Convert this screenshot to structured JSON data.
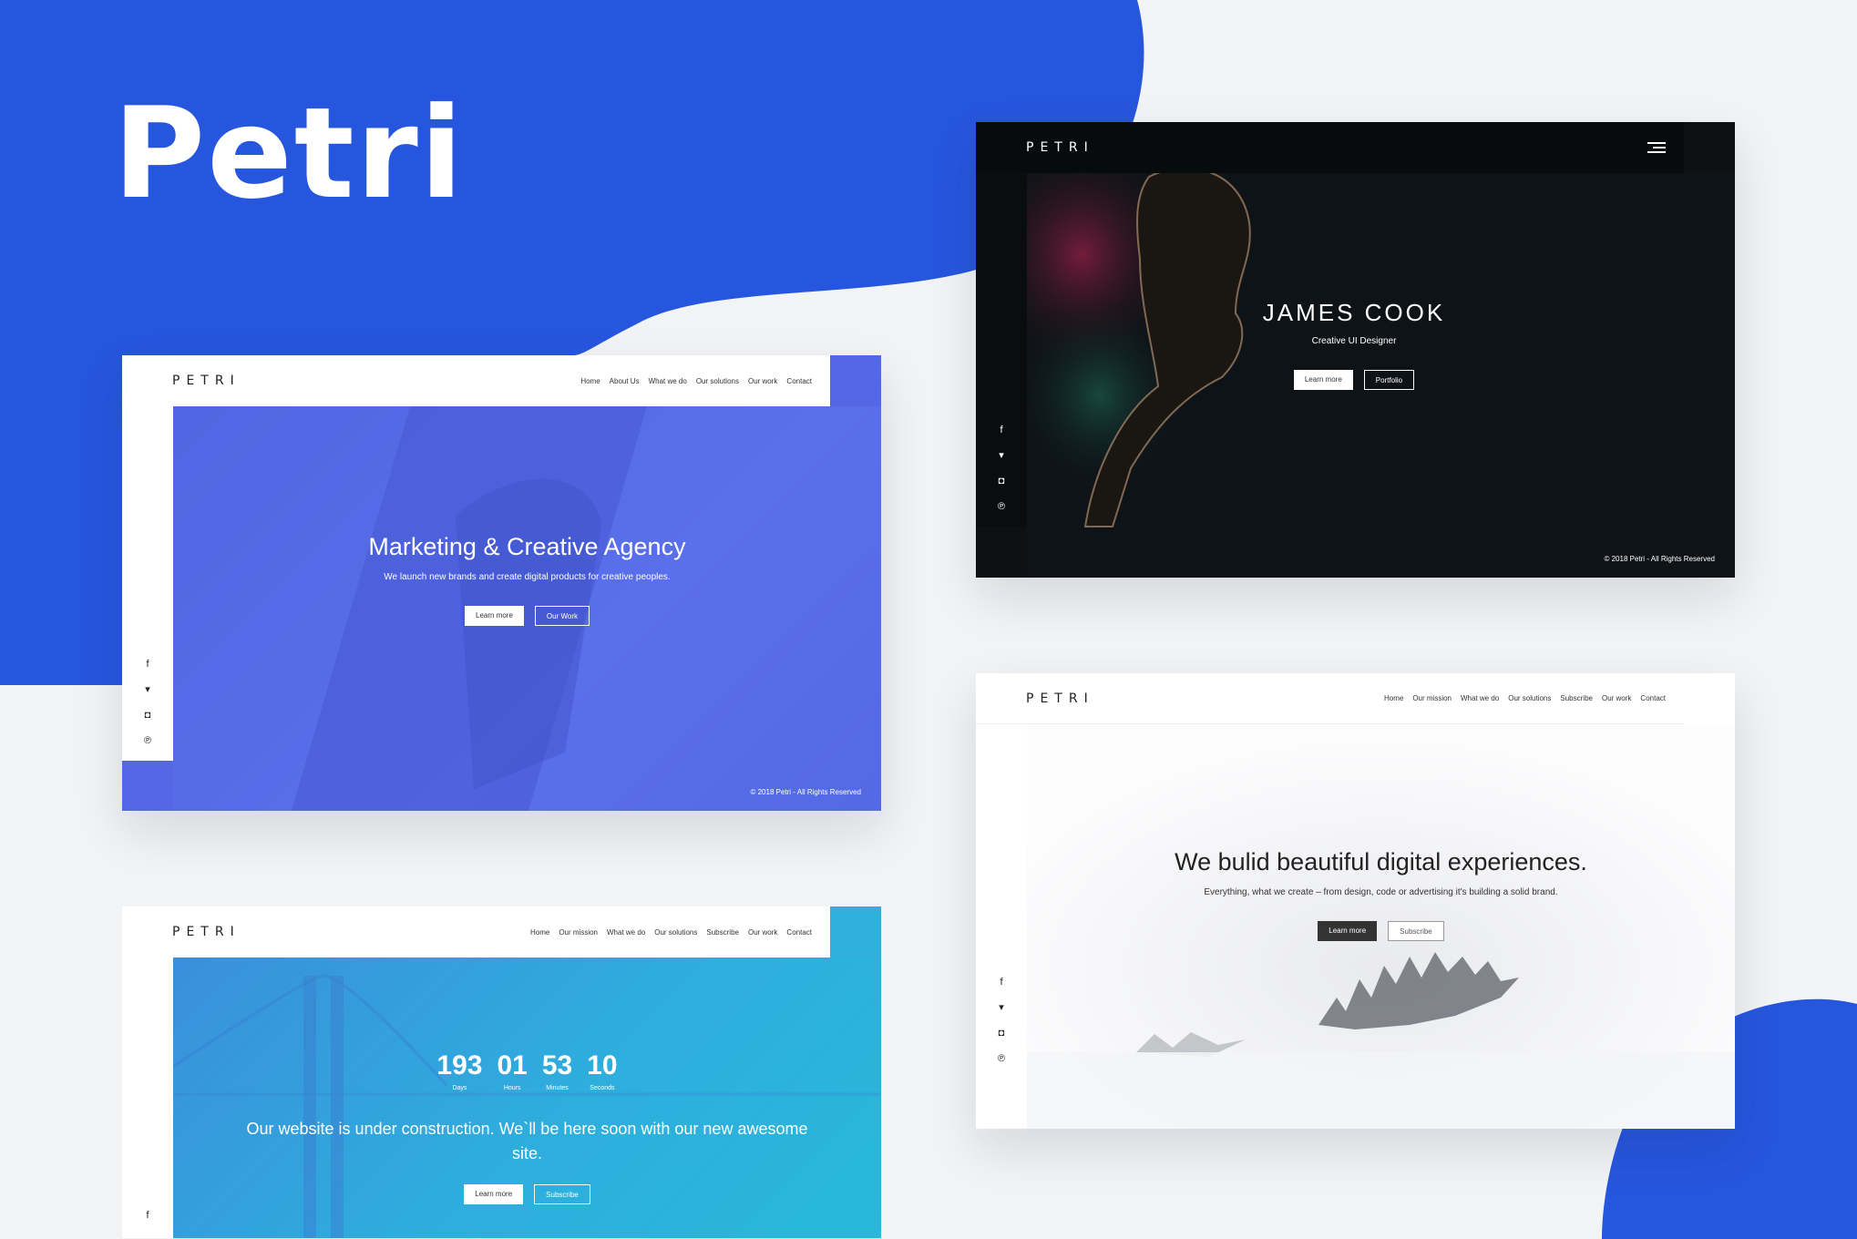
{
  "colors": {
    "brand_blue": "#2756de",
    "page_bg": "#f1f3f5"
  },
  "brand": {
    "title": "Petri"
  },
  "social_icons": [
    {
      "name": "facebook-icon",
      "glyph": "f"
    },
    {
      "name": "twitter-icon",
      "glyph": "🐦"
    },
    {
      "name": "instagram-icon",
      "glyph": "◘"
    },
    {
      "name": "pinterest-icon",
      "glyph": "℗"
    }
  ],
  "mock_agency": {
    "logo": "PETRI",
    "nav": [
      "Home",
      "About Us",
      "What we do",
      "Our solutions",
      "Our work",
      "Contact"
    ],
    "title": "Marketing & Creative Agency",
    "subtitle": "We launch new brands and create digital products for creative peoples.",
    "btn_primary": "Learn more",
    "btn_secondary": "Our Work",
    "footer": "© 2018 Petri - All Rights Reserved"
  },
  "mock_personal": {
    "logo": "PETRI",
    "title": "JAMES COOK",
    "subtitle": "Creative UI Designer",
    "btn_primary": "Learn more",
    "btn_secondary": "Portfolio",
    "footer": "© 2018 Petri - All Rights Reserved"
  },
  "mock_digital": {
    "logo": "PETRI",
    "nav": [
      "Home",
      "Our mission",
      "What we do",
      "Our solutions",
      "Subscribe",
      "Our work",
      "Contact"
    ],
    "title": "We bulid beautiful digital experiences.",
    "subtitle": "Everything, what we create – from design, code or advertising it's building a solid brand.",
    "btn_primary": "Learn more",
    "btn_secondary": "Subscribe"
  },
  "mock_construction": {
    "logo": "PETRI",
    "nav": [
      "Home",
      "Our mission",
      "What we do",
      "Our solutions",
      "Subscribe",
      "Our work",
      "Contact"
    ],
    "countdown": [
      {
        "value": "193",
        "label": "Days"
      },
      {
        "value": "01",
        "label": "Hours"
      },
      {
        "value": "53",
        "label": "Minutes"
      },
      {
        "value": "10",
        "label": "Seconds"
      }
    ],
    "message": "Our website is under construction. We`ll be here soon with our new awesome site.",
    "btn_primary": "Learn more",
    "btn_secondary": "Subscribe"
  }
}
